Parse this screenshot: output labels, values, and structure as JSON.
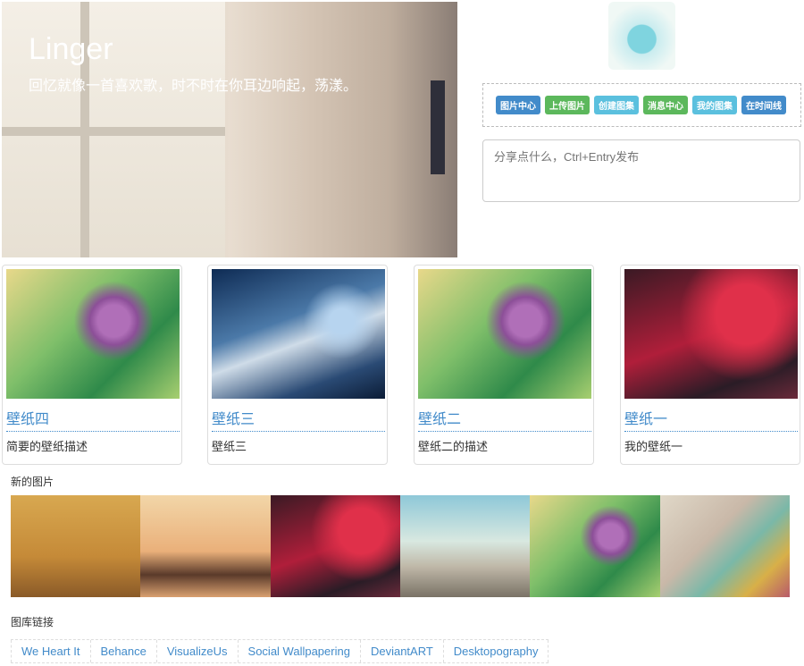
{
  "hero": {
    "title": "Linger",
    "subtitle": "回忆就像一首喜欢歌，时不时在你耳边响起，荡漾。"
  },
  "toolbar": {
    "buttons": [
      {
        "label": "图片中心",
        "color": "#428bca"
      },
      {
        "label": "上传图片",
        "color": "#5cb85c"
      },
      {
        "label": "创建图集",
        "color": "#5bc0de"
      },
      {
        "label": "消息中心",
        "color": "#5cb85c"
      },
      {
        "label": "我的图集",
        "color": "#5bc0de"
      },
      {
        "label": "在时间线",
        "color": "#428bca"
      }
    ]
  },
  "share": {
    "placeholder": "分享点什么，Ctrl+Entry发布"
  },
  "cards": [
    {
      "title": "壁纸四",
      "desc": "简要的壁纸描述"
    },
    {
      "title": "壁纸三",
      "desc": "壁纸三"
    },
    {
      "title": "壁纸二",
      "desc": "壁纸二的描述"
    },
    {
      "title": "壁纸一",
      "desc": "我的壁纸一"
    }
  ],
  "new_images": {
    "label": "新的图片"
  },
  "gallery_links": {
    "label": "图库链接",
    "links": [
      "We Heart It",
      "Behance",
      "VisualizeUs",
      "Social Wallpapering",
      "DeviantART",
      "Desktopography"
    ]
  }
}
